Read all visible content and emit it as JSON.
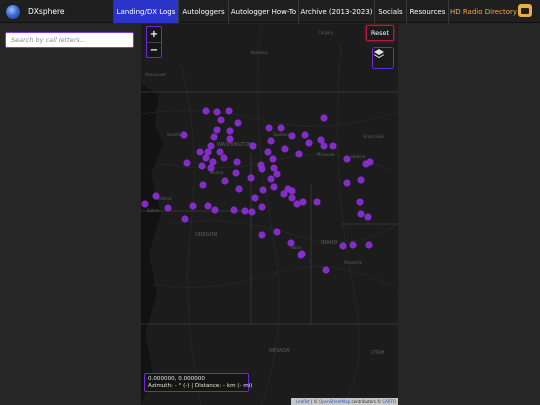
{
  "brand": {
    "name": "DXsphere",
    "icon": "globe-icon"
  },
  "nav": [
    {
      "label": "Landing/DX Logs",
      "active": true
    },
    {
      "label": "Autologgers",
      "active": false
    },
    {
      "label": "Autologger How-To",
      "active": false
    },
    {
      "label": "Archive (2013-2023)",
      "active": false
    },
    {
      "label": "Socials",
      "active": false
    },
    {
      "label": "Resources",
      "active": false
    },
    {
      "label": "HD Radio Directory",
      "active": false,
      "color": "#f0a94a",
      "icon": "radio-icon"
    }
  ],
  "search": {
    "placeholder": "Search by call letters..."
  },
  "map": {
    "zoom_in": "+",
    "zoom_out": "−",
    "reset_label": "Reset",
    "layers_icon": "layers-icon",
    "marker_color": "#8b2fd6",
    "coords_line": "0.000000, 0.000000",
    "azimuth_line": "Azimuth: - ° (-) | Distance: - km (- mi)",
    "attribution": {
      "leaflet": "Leaflet",
      "osm": "OpenStreetMap",
      "contrib": "contributors ©",
      "carto": "CARTO"
    },
    "labels": {
      "washington": "WASHINGTON",
      "oregon": "OREGON",
      "idaho": "IDAHO",
      "nevada": "NEVADA",
      "utah": "UTAH",
      "seattle": "Seattle",
      "portland": "Portland",
      "spokane": "Spokane",
      "boise": "Boise",
      "calgary": "Calgary",
      "great_falls": "Great Falls",
      "helena": "Helena",
      "missoula": "Missoula",
      "pocatello": "Pocatello",
      "salem": "Salem",
      "yakima": "Yakima",
      "kelowna": "Kelowna",
      "vancouver": "Vancouver"
    }
  }
}
